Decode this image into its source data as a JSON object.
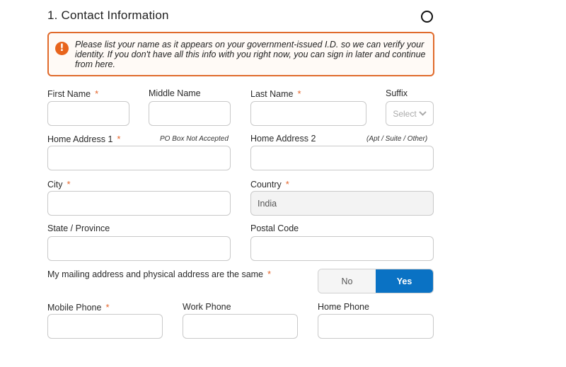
{
  "section": {
    "title": "1. Contact Information"
  },
  "alert": {
    "icon": "!",
    "message": "Please list your name as it appears on your government-issued I.D. so we can verify your identity. If you don't have all this info with you right now, you can sign in later and continue from here."
  },
  "required_mark": "*",
  "fields": {
    "first_name": {
      "label": "First Name",
      "value": ""
    },
    "middle_name": {
      "label": "Middle Name",
      "value": ""
    },
    "last_name": {
      "label": "Last Name",
      "value": ""
    },
    "suffix": {
      "label": "Suffix",
      "placeholder": "Select"
    },
    "home_address_1": {
      "label": "Home Address 1",
      "note": "PO Box Not Accepted",
      "value": ""
    },
    "home_address_2": {
      "label": "Home Address 2",
      "note": "(Apt / Suite / Other)",
      "value": ""
    },
    "city": {
      "label": "City",
      "value": ""
    },
    "country": {
      "label": "Country",
      "value": "India"
    },
    "state": {
      "label": "State / Province",
      "value": ""
    },
    "postal_code": {
      "label": "Postal Code",
      "value": ""
    },
    "mobile_phone": {
      "label": "Mobile Phone",
      "value": ""
    },
    "work_phone": {
      "label": "Work Phone",
      "value": ""
    },
    "home_phone": {
      "label": "Home Phone",
      "value": ""
    }
  },
  "mailing_same": {
    "label": "My mailing address and physical address are the same",
    "options": [
      "No",
      "Yes"
    ],
    "selected": "Yes"
  },
  "colors": {
    "accent": "#0a72c4",
    "required": "#e4642a",
    "alert_border": "#e06a2b"
  }
}
